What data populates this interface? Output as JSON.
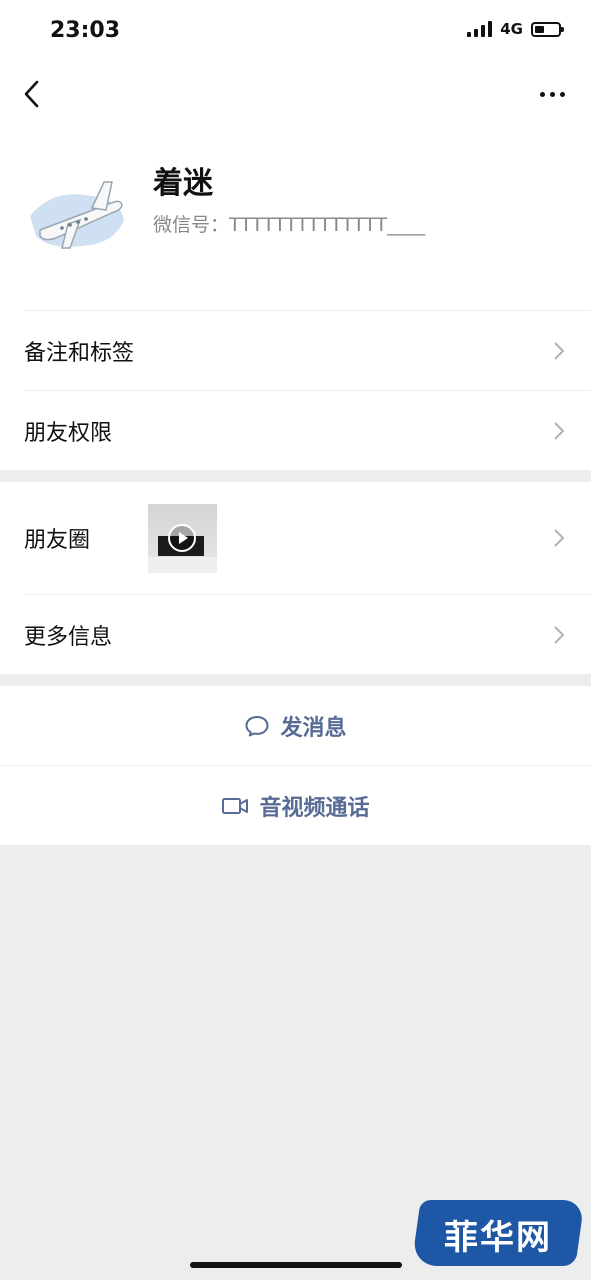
{
  "status_bar": {
    "time": "23:03",
    "network": "4G",
    "battery_level": 0.4
  },
  "nav": {
    "back_icon": "back-chevron-icon",
    "more_icon": "more-dots-icon"
  },
  "profile": {
    "name": "着迷",
    "wechat_id_label": "微信号：",
    "wechat_id": "TTTTTTTTTTTTTT____"
  },
  "menu": {
    "remark_tags": "备注和标签",
    "friend_permissions": "朋友权限",
    "moments": "朋友圈",
    "more_info": "更多信息"
  },
  "actions": {
    "send_message": "发消息",
    "video_call": "音视频通话"
  },
  "watermark": "菲华网",
  "colors": {
    "link": "#576b95",
    "background": "#ededed",
    "brand_blue": "#1e57a6"
  }
}
